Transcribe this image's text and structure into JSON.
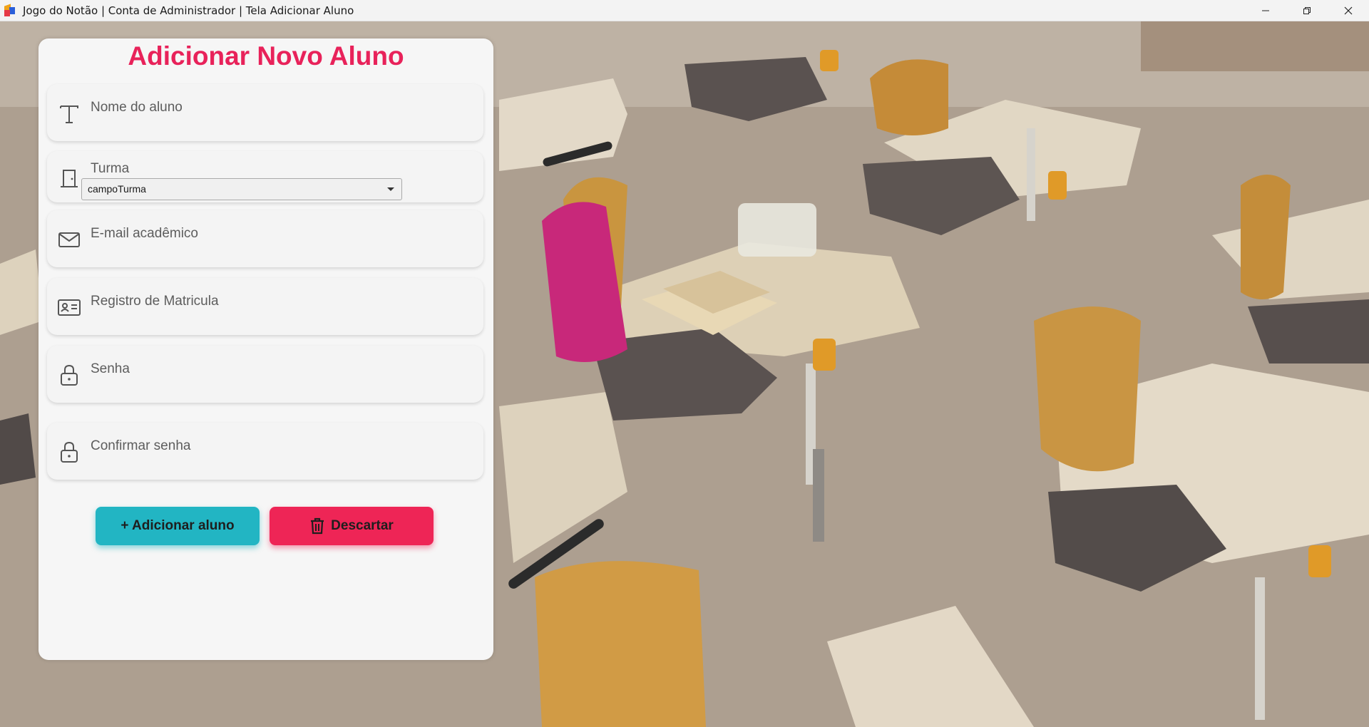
{
  "window": {
    "title": "Jogo do Notão | Conta de Administrador | Tela Adicionar Aluno"
  },
  "form": {
    "title": "Adicionar Novo Aluno",
    "fields": [
      {
        "label": "Nome do aluno",
        "icon": "text-icon"
      },
      {
        "label": "Turma",
        "icon": "door-icon",
        "select_value": "campoTurma"
      },
      {
        "label": "E-mail acadêmico",
        "icon": "mail-icon"
      },
      {
        "label": "Registro de Matricula",
        "icon": "id-card-icon"
      },
      {
        "label": "Senha",
        "icon": "lock-icon"
      },
      {
        "label": "Confirmar senha",
        "icon": "lock-icon"
      }
    ],
    "buttons": {
      "add": "+ Adicionar aluno",
      "discard": "Descartar"
    }
  },
  "colors": {
    "accent_title": "#e8225a",
    "add_button": "#22b5c3",
    "discard_button": "#ee2556"
  }
}
